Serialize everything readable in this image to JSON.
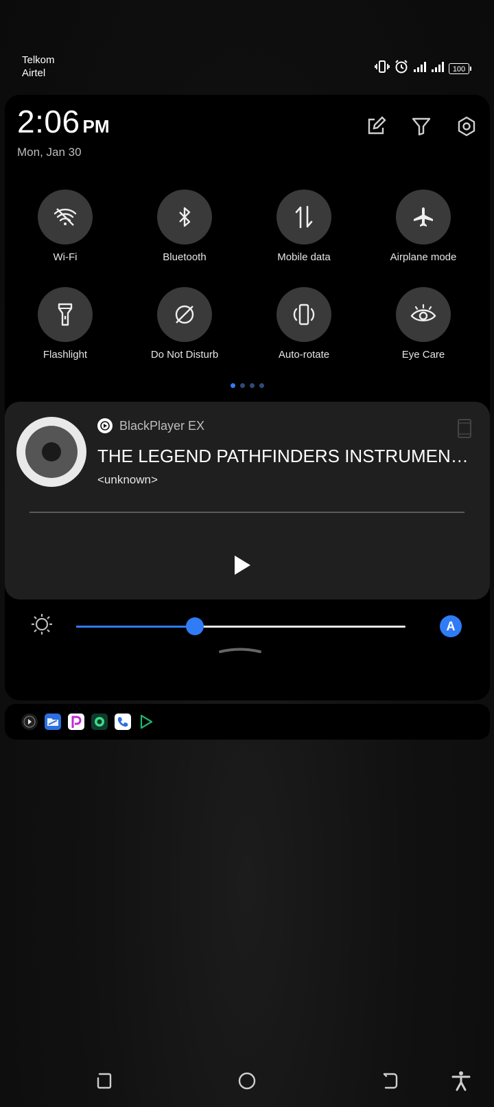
{
  "status_bar": {
    "carrier_1": "Telkom",
    "carrier_2": "Airtel",
    "battery_level": "100",
    "icons": [
      "vibrate-icon",
      "alarm-icon",
      "signal-1-icon",
      "signal-2-icon",
      "battery-icon"
    ]
  },
  "header": {
    "time": "2:06",
    "ampm": "PM",
    "date": "Mon, Jan 30",
    "actions": [
      "edit-icon",
      "filter-icon",
      "settings-icon"
    ]
  },
  "quick_tiles": [
    {
      "label": "Wi-Fi",
      "icon": "wifi-off-icon"
    },
    {
      "label": "Bluetooth",
      "icon": "bluetooth-icon"
    },
    {
      "label": "Mobile data",
      "icon": "mobile-data-icon"
    },
    {
      "label": "Airplane mode",
      "icon": "airplane-icon"
    },
    {
      "label": "Flashlight",
      "icon": "flashlight-icon"
    },
    {
      "label": "Do Not Disturb",
      "icon": "do-not-disturb-icon"
    },
    {
      "label": "Auto-rotate",
      "icon": "auto-rotate-icon"
    },
    {
      "label": "Eye Care",
      "icon": "eye-care-icon"
    }
  ],
  "page_indicator": {
    "pages": 4,
    "active": 1
  },
  "media": {
    "app_name": "BlackPlayer EX",
    "title": "THE LEGEND PATHFINDERS INSTRUMENTAL",
    "artist": "<unknown>",
    "state": "paused"
  },
  "brightness": {
    "level": 0.36,
    "auto_label": "A",
    "accent": "#2f7cf6"
  },
  "notification_apps": [
    "blackplayer-icon",
    "files-icon",
    "picsart-icon",
    "green-app-icon",
    "phone-icon",
    "play-games-icon"
  ],
  "nav_bar": [
    "recents-icon",
    "home-icon",
    "back-icon",
    "accessibility-icon"
  ]
}
